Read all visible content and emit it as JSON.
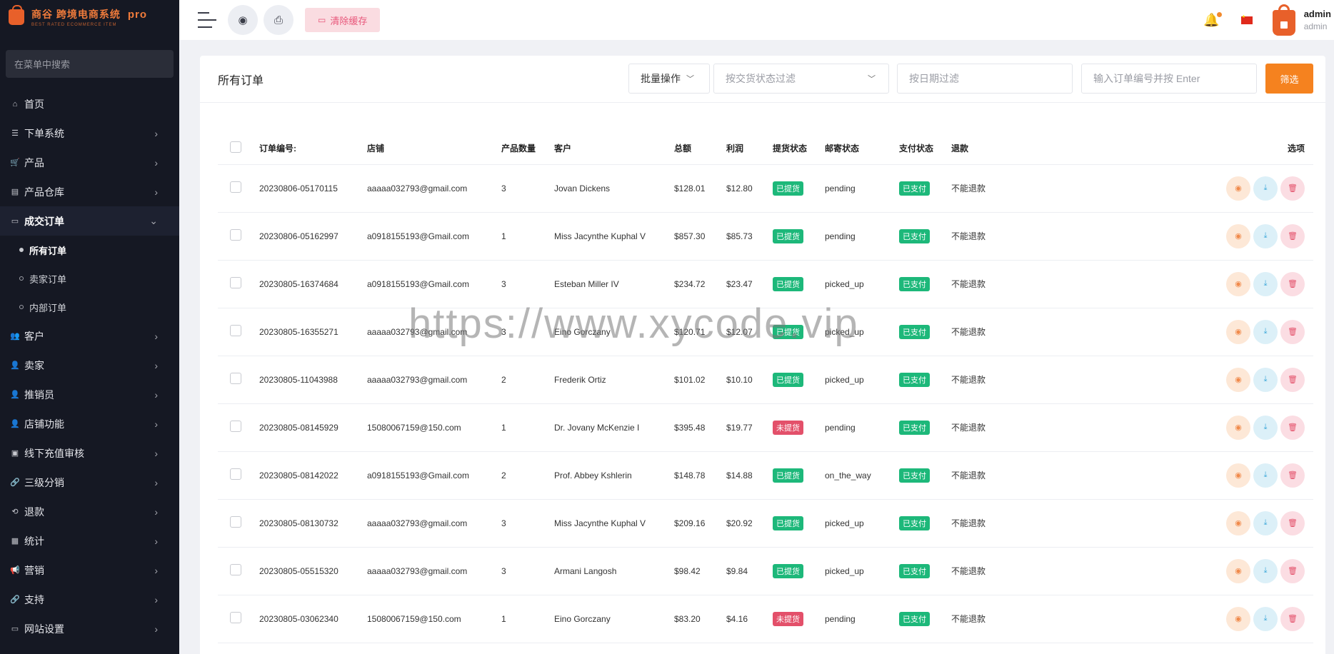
{
  "brand": {
    "name": "商谷 跨境电商系统",
    "pro": "pro",
    "slogan": "BEST RATED ECOMMERCE ITEM"
  },
  "sidebar": {
    "search_placeholder": "在菜单中搜索",
    "items": [
      {
        "label": "首页",
        "icon": "home-icon",
        "glyph": "⌂",
        "chevron": false
      },
      {
        "label": "下单系统",
        "icon": "list-icon",
        "glyph": "☰",
        "chevron": true
      },
      {
        "label": "产品",
        "icon": "cart-icon",
        "glyph": "🛒",
        "chevron": true
      },
      {
        "label": "产品仓库",
        "icon": "warehouse-icon",
        "glyph": "▤",
        "chevron": true
      },
      {
        "label": "成交订单",
        "icon": "order-icon",
        "glyph": "▭",
        "chevron": true,
        "expanded": true
      }
    ],
    "sub_items": [
      "所有订单",
      "卖家订单",
      "内部订单"
    ],
    "items_after": [
      {
        "label": "客户",
        "icon": "customers-icon",
        "glyph": "👥"
      },
      {
        "label": "卖家",
        "icon": "seller-icon",
        "glyph": "👤"
      },
      {
        "label": "推销员",
        "icon": "salesman-icon",
        "glyph": "👤"
      },
      {
        "label": "店铺功能",
        "icon": "shop-icon",
        "glyph": "👤"
      },
      {
        "label": "线下充值审核",
        "icon": "recharge-icon",
        "glyph": "▣"
      },
      {
        "label": "三级分销",
        "icon": "link-icon",
        "glyph": "🔗"
      },
      {
        "label": "退款",
        "icon": "refund-icon",
        "glyph": "⟲"
      },
      {
        "label": "统计",
        "icon": "stats-icon",
        "glyph": "▦"
      },
      {
        "label": "营销",
        "icon": "marketing-icon",
        "glyph": "📢"
      },
      {
        "label": "支持",
        "icon": "support-icon",
        "glyph": "🔗"
      },
      {
        "label": "网站设置",
        "icon": "settings-icon",
        "glyph": "▭"
      }
    ]
  },
  "header": {
    "clear_cache": "清除缓存",
    "user_name": "admin",
    "user_role": "admin"
  },
  "card": {
    "title": "所有订单",
    "batch": "批量操作",
    "status_filter": "按交货状态过滤",
    "date_filter": "按日期过滤",
    "order_search": "输入订单编号并按 Enter",
    "filter_btn": "筛选"
  },
  "columns": [
    "订单编号:",
    "店铺",
    "产品数量",
    "客户",
    "总额",
    "利润",
    "提货状态",
    "邮寄状态",
    "支付状态",
    "退款",
    "选项"
  ],
  "rows": [
    {
      "id": "20230806-05170115",
      "shop": "aaaaa032793@gmail.com",
      "qty": "3",
      "customer": "Jovan Dickens",
      "total": "$128.01",
      "profit": "$12.80",
      "pickup": "已提货",
      "pickup_ok": true,
      "mail": "pending",
      "pay": "已支付",
      "refund": "不能退款"
    },
    {
      "id": "20230806-05162997",
      "shop": "a0918155193@Gmail.com",
      "qty": "1",
      "customer": "Miss Jacynthe Kuphal V",
      "total": "$857.30",
      "profit": "$85.73",
      "pickup": "已提货",
      "pickup_ok": true,
      "mail": "pending",
      "pay": "已支付",
      "refund": "不能退款"
    },
    {
      "id": "20230805-16374684",
      "shop": "a0918155193@Gmail.com",
      "qty": "3",
      "customer": "Esteban Miller IV",
      "total": "$234.72",
      "profit": "$23.47",
      "pickup": "已提货",
      "pickup_ok": true,
      "mail": "picked_up",
      "pay": "已支付",
      "refund": "不能退款"
    },
    {
      "id": "20230805-16355271",
      "shop": "aaaaa032793@gmail.com",
      "qty": "3",
      "customer": "Eino Gorczany",
      "total": "$120.71",
      "profit": "$12.07",
      "pickup": "已提货",
      "pickup_ok": true,
      "mail": "picked_up",
      "pay": "已支付",
      "refund": "不能退款"
    },
    {
      "id": "20230805-11043988",
      "shop": "aaaaa032793@gmail.com",
      "qty": "2",
      "customer": "Frederik Ortiz",
      "total": "$101.02",
      "profit": "$10.10",
      "pickup": "已提货",
      "pickup_ok": true,
      "mail": "picked_up",
      "pay": "已支付",
      "refund": "不能退款"
    },
    {
      "id": "20230805-08145929",
      "shop": "15080067159@150.com",
      "qty": "1",
      "customer": "Dr. Jovany McKenzie I",
      "total": "$395.48",
      "profit": "$19.77",
      "pickup": "未提货",
      "pickup_ok": false,
      "mail": "pending",
      "pay": "已支付",
      "refund": "不能退款"
    },
    {
      "id": "20230805-08142022",
      "shop": "a0918155193@Gmail.com",
      "qty": "2",
      "customer": "Prof. Abbey Kshlerin",
      "total": "$148.78",
      "profit": "$14.88",
      "pickup": "已提货",
      "pickup_ok": true,
      "mail": "on_the_way",
      "pay": "已支付",
      "refund": "不能退款"
    },
    {
      "id": "20230805-08130732",
      "shop": "aaaaa032793@gmail.com",
      "qty": "3",
      "customer": "Miss Jacynthe Kuphal V",
      "total": "$209.16",
      "profit": "$20.92",
      "pickup": "已提货",
      "pickup_ok": true,
      "mail": "picked_up",
      "pay": "已支付",
      "refund": "不能退款"
    },
    {
      "id": "20230805-05515320",
      "shop": "aaaaa032793@gmail.com",
      "qty": "3",
      "customer": "Armani Langosh",
      "total": "$98.42",
      "profit": "$9.84",
      "pickup": "已提货",
      "pickup_ok": true,
      "mail": "picked_up",
      "pay": "已支付",
      "refund": "不能退款"
    },
    {
      "id": "20230805-03062340",
      "shop": "15080067159@150.com",
      "qty": "1",
      "customer": "Eino Gorczany",
      "total": "$83.20",
      "profit": "$4.16",
      "pickup": "未提货",
      "pickup_ok": false,
      "mail": "pending",
      "pay": "已支付",
      "refund": "不能退款"
    }
  ],
  "watermark": "https://www.xycode.vip"
}
